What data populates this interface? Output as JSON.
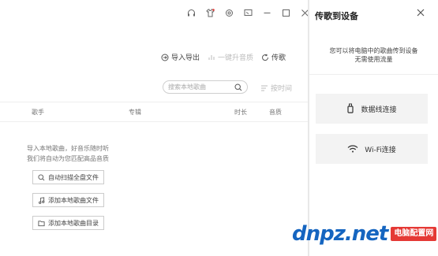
{
  "toolbar": {
    "import_export": "导入导出",
    "one_click_upgrade": "一键升音质",
    "transfer": "传歌"
  },
  "search": {
    "placeholder": "搜索本地歌曲"
  },
  "sort": {
    "label": "按时间"
  },
  "table": {
    "columns": [
      "歌手",
      "专辑",
      "时长",
      "音质"
    ]
  },
  "empty": {
    "line1": "导入本地歌曲，好音乐随时听",
    "line2": "我们将自动为您匹配高品音质"
  },
  "actions": {
    "scan": "自动扫描全盘文件",
    "add_files": "添加本地歌曲文件",
    "add_dir": "添加本地歌曲目录"
  },
  "panel": {
    "title": "传歌到设备",
    "desc_line1": "您可以将电脑中的歌曲传到设备",
    "desc_line2": "无需使用流量",
    "usb_label": "数据线连接",
    "wifi_label": "Wi-Fi连接"
  },
  "watermark": {
    "text": "dnpz.net",
    "badge": "电脑配置网"
  },
  "colors": {
    "accent": "#1565c0",
    "badge": "#e53935"
  }
}
